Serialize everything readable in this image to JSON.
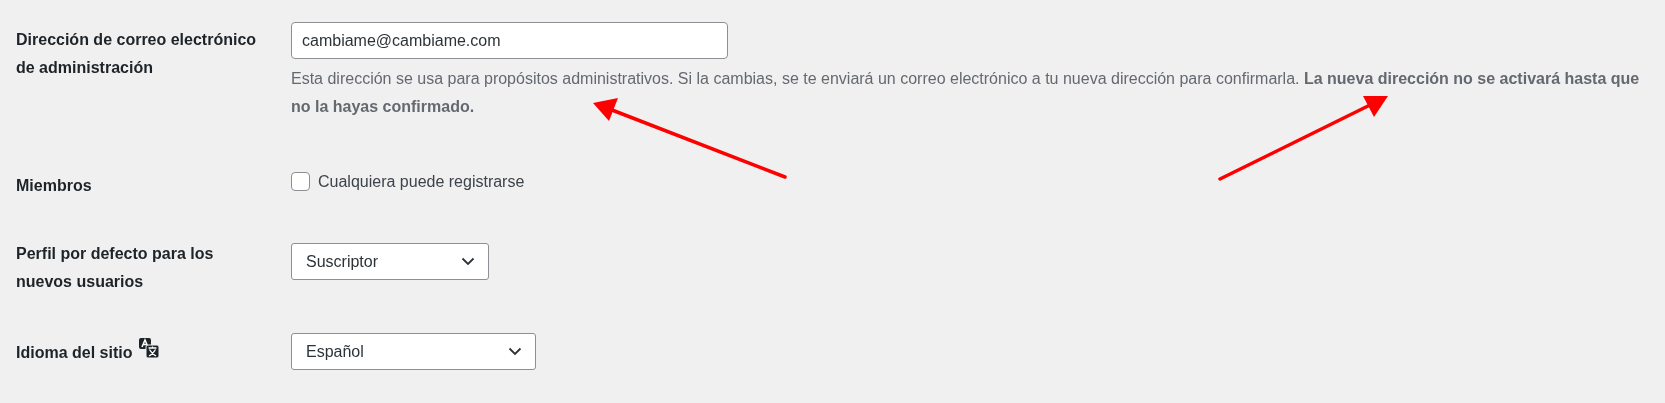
{
  "settings": [
    {
      "kind": "email",
      "label": "Dirección de correo electrónico de administración",
      "value": "cambiame@cambiame.com",
      "description": "Esta dirección se usa para propósitos administrativos. Si la cambias, se te enviará un correo electrónico a tu nueva dirección para confirmarla. **La nueva dirección no se activará hasta que no la hayas confirmado.**"
    },
    {
      "kind": "checkbox",
      "label": "Miembros",
      "option": "Cualquiera puede registrarse",
      "checked": false
    },
    {
      "kind": "select",
      "label": "Perfil por defecto para los nuevos usuarios",
      "value": "Suscriptor"
    },
    {
      "kind": "select-wide",
      "label": "Idioma del sitio",
      "value": "Español",
      "label_icon": true
    }
  ]
}
